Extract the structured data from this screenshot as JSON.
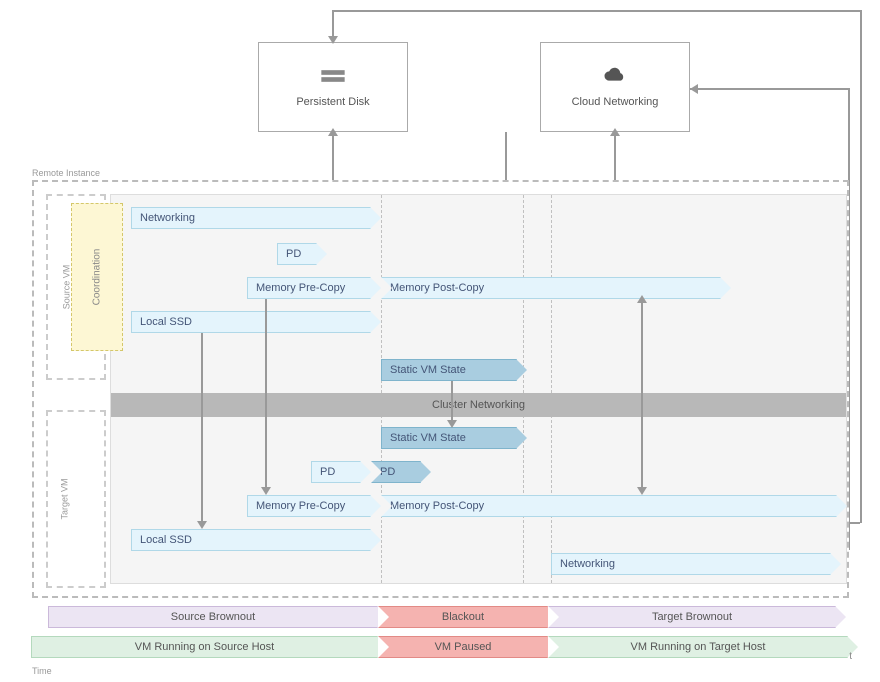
{
  "top": {
    "persistent_disk": "Persistent Disk",
    "cloud_networking": "Cloud Networking"
  },
  "remote_instance_label": "Remote Instance",
  "source_vm_label": "Source VM",
  "target_vm_label": "Target VM",
  "coordination_label": "Coordination",
  "cluster_networking": "Cluster Networking",
  "lanes": {
    "networking_source": "Networking",
    "pd_source": "PD",
    "memory_precopy_source": "Memory Pre-Copy",
    "memory_postcopy_source": "Memory Post-Copy",
    "local_ssd_source": "Local SSD",
    "static_vm_state_source": "Static VM State",
    "static_vm_state_target": "Static VM State",
    "pd_target_1": "PD",
    "pd_target_2": "PD",
    "memory_precopy_target": "Memory Pre-Copy",
    "memory_postcopy_target": "Memory Post-Copy",
    "local_ssd_target": "Local SSD",
    "networking_target": "Networking"
  },
  "phases": {
    "source_brownout": "Source Brownout",
    "blackout": "Blackout",
    "target_brownout": "Target Brownout",
    "vm_running_source": "VM Running on Source Host",
    "vm_paused": "VM Paused",
    "vm_running_target": "VM Running on Target Host"
  },
  "time_label": "Time",
  "time_end": "t"
}
